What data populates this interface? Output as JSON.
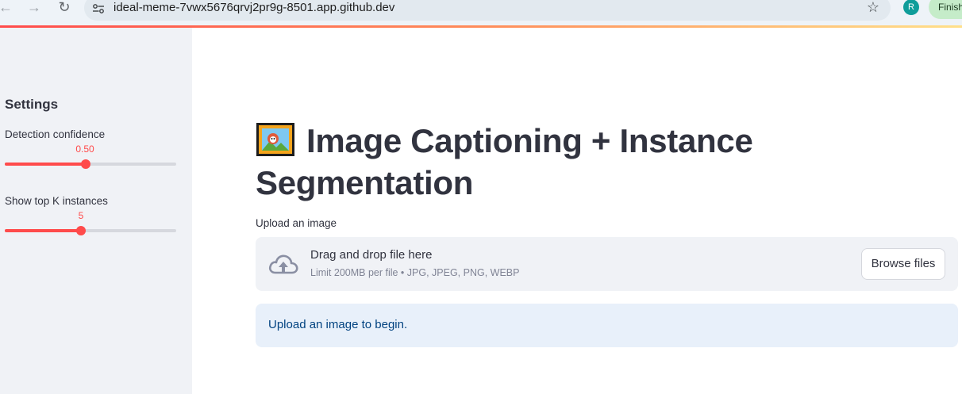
{
  "browser": {
    "url": "ideal-meme-7vwx5676qrvj2pr9g-8501.app.github.dev",
    "avatar_letter": "R",
    "finish_label": "Finish"
  },
  "sidebar": {
    "title": "Settings",
    "sliders": [
      {
        "label": "Detection confidence",
        "value": "0.50",
        "fraction": 0.47
      },
      {
        "label": "Show top K instances",
        "value": "5",
        "fraction": 0.44
      }
    ]
  },
  "main": {
    "title_line1": "Image Captioning + Instance",
    "title_line2": "Segmentation",
    "title_icon": "framed-picture-icon",
    "upload": {
      "label": "Upload an image",
      "drop_text": "Drag and drop file here",
      "limit_text": "Limit 200MB per file • JPG, JPEG, PNG, WEBP",
      "browse_label": "Browse files",
      "icon": "cloud-upload-icon"
    },
    "info_text": "Upload an image to begin."
  },
  "colors": {
    "accent": "#ff4b4b",
    "sidebar_bg": "#f0f2f6",
    "info_bg": "#e8f0fa",
    "info_text": "#004280"
  }
}
